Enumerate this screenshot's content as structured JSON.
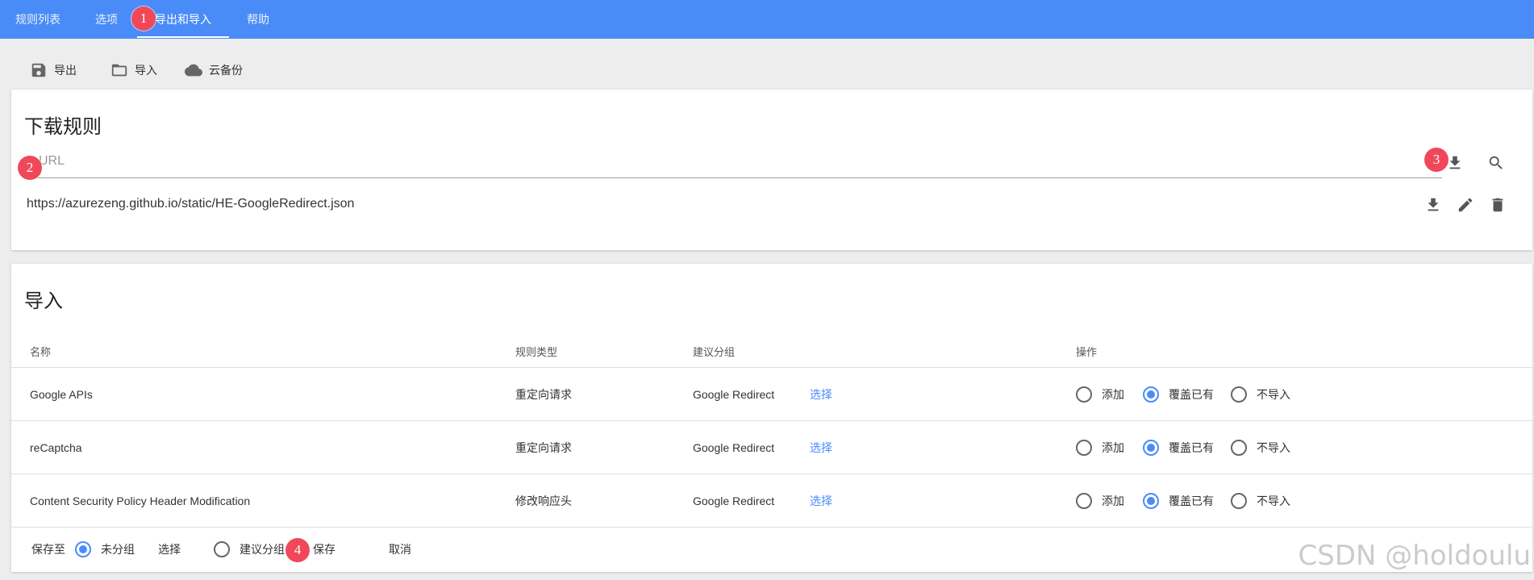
{
  "tabs": [
    {
      "label": "规则列表"
    },
    {
      "label": "选项"
    },
    {
      "label": "导出和导入",
      "active": true
    },
    {
      "label": "帮助"
    }
  ],
  "toolbar": {
    "export_label": "导出",
    "import_label": "导入",
    "cloud_label": "云备份"
  },
  "download": {
    "title": "下载规则",
    "url_placeholder": "URL",
    "rules": [
      {
        "url": "https://azurezeng.github.io/static/HE-GoogleRedirect.json"
      }
    ]
  },
  "import": {
    "title": "导入",
    "columns": {
      "name": "名称",
      "type": "规则类型",
      "group": "建议分组",
      "action": "操作"
    },
    "select_label": "选择",
    "options": {
      "add": "添加",
      "overwrite": "覆盖已有",
      "skip": "不导入"
    },
    "rows": [
      {
        "name": "Google APIs",
        "type": "重定向请求",
        "group": "Google Redirect",
        "selected": "overwrite"
      },
      {
        "name": "reCaptcha",
        "type": "重定向请求",
        "group": "Google Redirect",
        "selected": "overwrite"
      },
      {
        "name": "Content Security Policy Header Modification",
        "type": "修改响应头",
        "group": "Google Redirect",
        "selected": "overwrite"
      }
    ],
    "footer": {
      "save_to_label": "保存至",
      "ungrouped_label": "未分组",
      "select_label": "选择",
      "suggested_label": "建议分组",
      "save_label": "保存",
      "cancel_label": "取消",
      "selected": "ungrouped"
    }
  },
  "markers": [
    "1",
    "2",
    "3",
    "4"
  ],
  "watermark": "CSDN @holdoulu",
  "colors": {
    "accent": "#4a8cf7",
    "marker": "#f0485a"
  }
}
